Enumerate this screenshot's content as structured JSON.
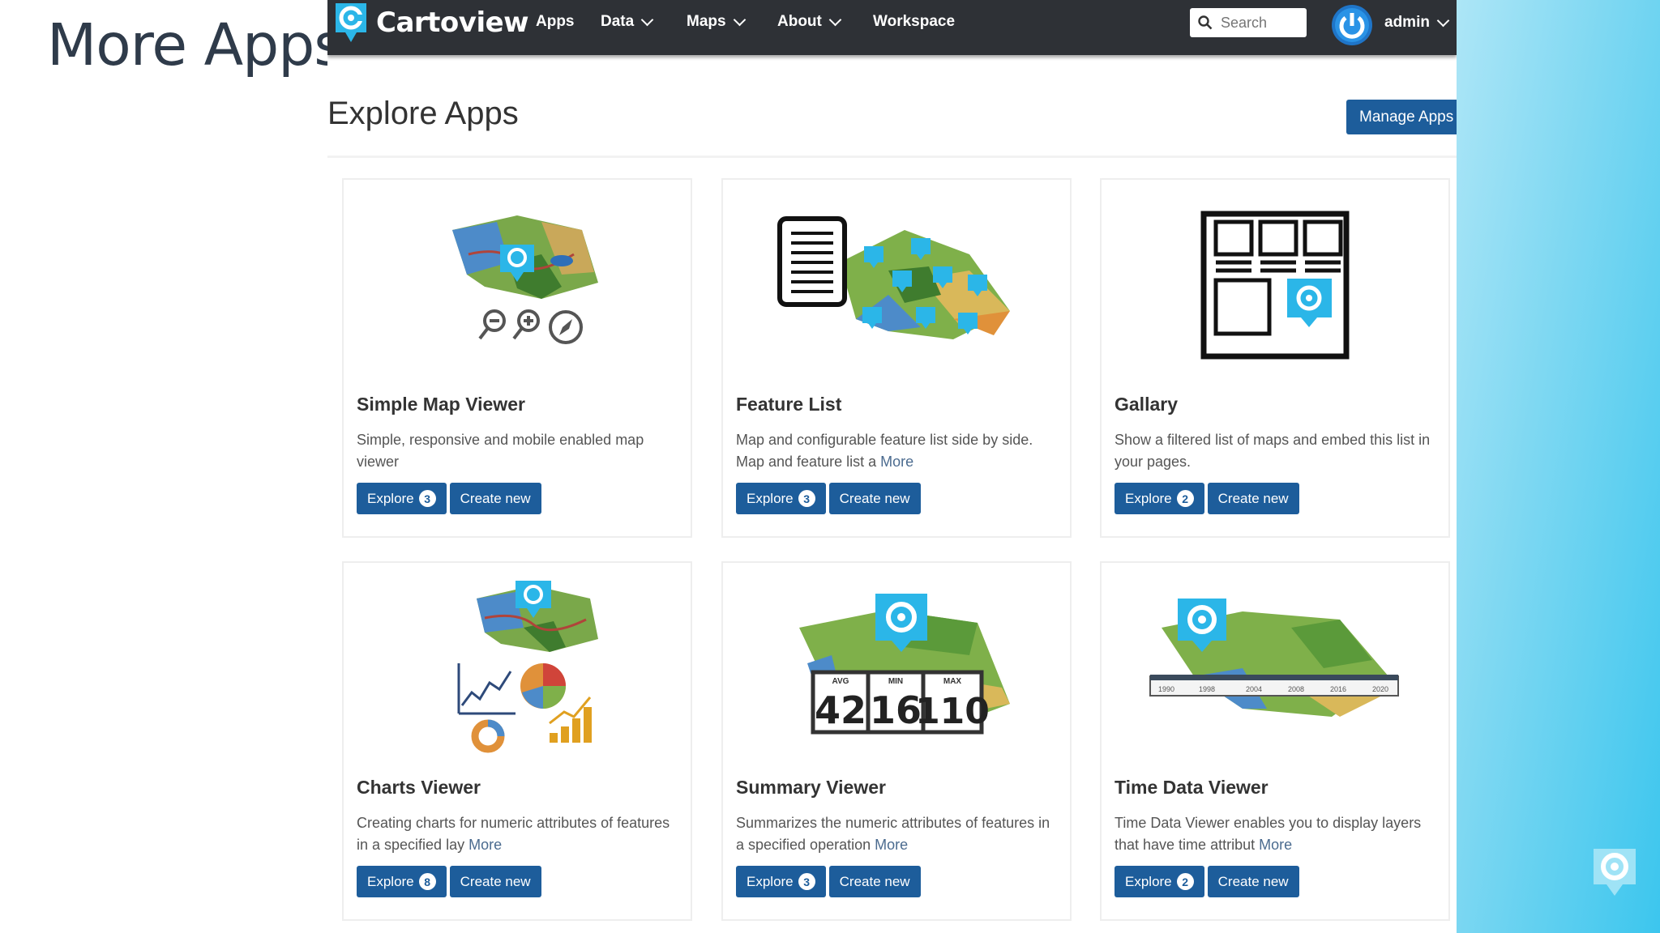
{
  "slide": {
    "title": "More Apps"
  },
  "navbar": {
    "brand": "Cartoview",
    "items": [
      {
        "label": "Apps",
        "dropdown": false
      },
      {
        "label": "Data",
        "dropdown": true
      },
      {
        "label": "Maps",
        "dropdown": true
      },
      {
        "label": "About",
        "dropdown": true
      },
      {
        "label": "Workspace",
        "dropdown": false
      }
    ],
    "search_placeholder": "Search",
    "user": "admin"
  },
  "page": {
    "title": "Explore Apps",
    "manage_label": "Manage Apps"
  },
  "cards": [
    {
      "title": "Simple Map Viewer",
      "desc": "Simple, responsive and mobile enabled map viewer",
      "more": "",
      "explore": "Explore",
      "count": "3",
      "create": "Create new",
      "icon": "simple-map-viewer-illustration"
    },
    {
      "title": "Feature List",
      "desc": "Map and configurable feature list side by side. Map and feature list a ",
      "more": "More",
      "explore": "Explore",
      "count": "3",
      "create": "Create new",
      "icon": "feature-list-illustration"
    },
    {
      "title": "Gallary",
      "desc": "Show a filtered list of maps and embed this list in your pages.",
      "more": "",
      "explore": "Explore",
      "count": "2",
      "create": "Create new",
      "icon": "gallery-illustration"
    },
    {
      "title": "Charts Viewer",
      "desc": "Creating charts for numeric attributes of features in a specified lay ",
      "more": "More",
      "explore": "Explore",
      "count": "8",
      "create": "Create new",
      "icon": "charts-viewer-illustration"
    },
    {
      "title": "Summary Viewer",
      "desc": "Summarizes the numeric attributes of features in a specified operation ",
      "more": "More",
      "explore": "Explore",
      "count": "3",
      "create": "Create new",
      "icon": "summary-viewer-illustration"
    },
    {
      "title": "Time Data Viewer",
      "desc": "Time Data Viewer enables you to display layers that have time attribut ",
      "more": "More",
      "explore": "Explore",
      "count": "2",
      "create": "Create new",
      "icon": "time-data-viewer-illustration"
    }
  ],
  "summary_stats": {
    "avg_label": "AVG",
    "avg": "42",
    "min_label": "MIN",
    "min": "16",
    "max_label": "MAX",
    "max": "110"
  },
  "timeline_years": [
    "1990",
    "1998",
    "2004",
    "2008",
    "2016",
    "2020"
  ],
  "colors": {
    "navbar": "#2e3136",
    "button": "#1d5d9b",
    "brand_accent": "#2bb6e8"
  }
}
